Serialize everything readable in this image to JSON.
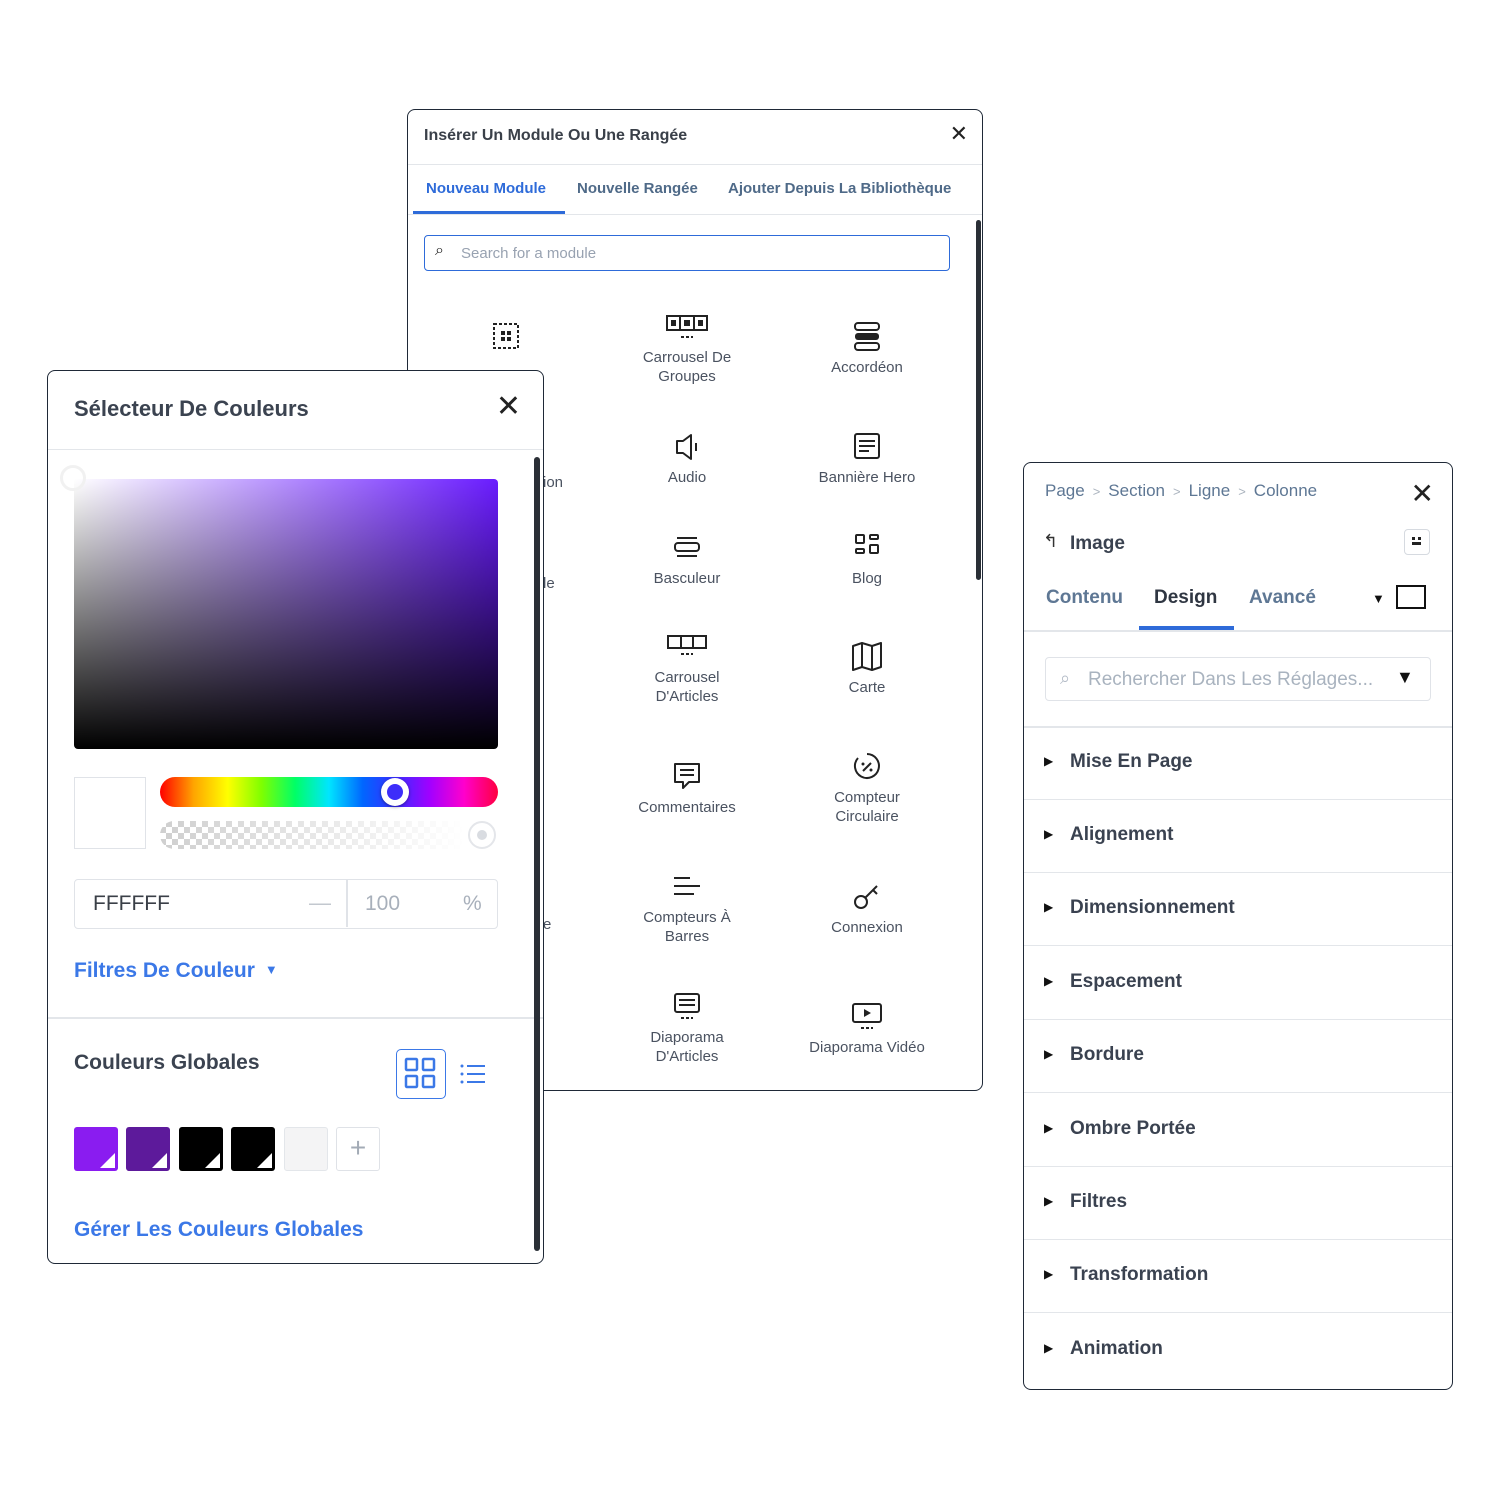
{
  "insert_panel": {
    "title": "Insérer Un Module Ou Une Rangée",
    "close_glyph": "✕",
    "tabs": [
      {
        "label": "Nouveau Module",
        "active": true
      },
      {
        "label": "Nouvelle Rangée",
        "active": false
      },
      {
        "label": "Ajouter Depuis La Bibliothèque",
        "active": false
      }
    ],
    "search_placeholder": "Search for a module",
    "modules": [
      {
        "label": "Carrousel De\nGroupes",
        "icon": "group-carousel-icon"
      },
      {
        "label": "Accordéon",
        "icon": "accordion-icon"
      },
      {
        "label": "Audio",
        "icon": "audio-icon"
      },
      {
        "label": "Bannière Hero",
        "icon": "hero-banner-icon"
      },
      {
        "label": "Basculeur",
        "icon": "toggle-icon"
      },
      {
        "label": "Blog",
        "icon": "blog-icon"
      },
      {
        "label": "Carrousel\nD'Articles",
        "icon": "post-carousel-icon"
      },
      {
        "label": "Carte",
        "icon": "map-icon"
      },
      {
        "label": "Commentaires",
        "icon": "comments-icon"
      },
      {
        "label": "Compteur\nCirculaire",
        "icon": "circle-counter-icon"
      },
      {
        "label": "Compteurs À\nBarres",
        "icon": "bar-counter-icon"
      },
      {
        "label": "Connexion",
        "icon": "login-key-icon"
      },
      {
        "label": "Diaporama\nD'Articles",
        "icon": "post-slider-icon"
      },
      {
        "label": "Diaporama Vidéo",
        "icon": "video-slider-icon"
      }
    ],
    "partial_labels": [
      "ion",
      "le",
      "e"
    ]
  },
  "color_panel": {
    "title": "Sélecteur De Couleurs",
    "close_glyph": "✕",
    "hex_value": "FFFFFF",
    "opacity_value": "100",
    "opacity_unit": "%",
    "hue_color": "#3d2dfa",
    "filters_label": "Filtres De Couleur",
    "global_title": "Couleurs Globales",
    "global_swatches": [
      "#8a1cf0",
      "#5d1a9b",
      "#000000",
      "#000000",
      "#f4f4f5"
    ],
    "add_label": "+",
    "manage_label": "Gérer Les Couleurs Globales"
  },
  "settings_panel": {
    "breadcrumbs": [
      "Page",
      "Section",
      "Ligne",
      "Colonne"
    ],
    "close_glyph": "✕",
    "back_glyph": "↰",
    "module_name": "Image",
    "tabs": [
      {
        "label": "Contenu",
        "active": false
      },
      {
        "label": "Design",
        "active": true
      },
      {
        "label": "Avancé",
        "active": false
      }
    ],
    "search_placeholder": "Rechercher Dans Les Réglages...",
    "sections": [
      "Mise En Page",
      "Alignement",
      "Dimensionnement",
      "Espacement",
      "Bordure",
      "Ombre Portée",
      "Filtres",
      "Transformation",
      "Animation"
    ]
  }
}
